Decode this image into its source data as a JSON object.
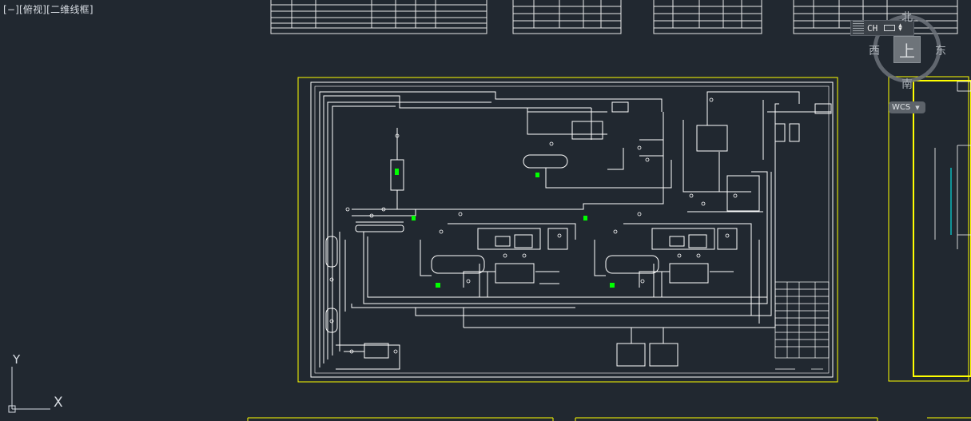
{
  "viewport": {
    "label": "[−][俯视][二维线框]"
  },
  "ime": {
    "language": "CH",
    "keyboard_icon": "keyboard-icon",
    "menu_icon": "menu-icon"
  },
  "viewcube": {
    "north": "北",
    "south": "南",
    "east": "东",
    "west": "西",
    "top_face": "上",
    "wcs_label": "WCS"
  },
  "ucs": {
    "x_label": "X",
    "y_label": "Y"
  },
  "colors": {
    "background": "#212830",
    "linework": "#ffffff",
    "border_frame": "#ffff00",
    "highlight": "#00ff00",
    "cyan_line": "#00ffff",
    "viewcube_ring": "#6c727a"
  }
}
